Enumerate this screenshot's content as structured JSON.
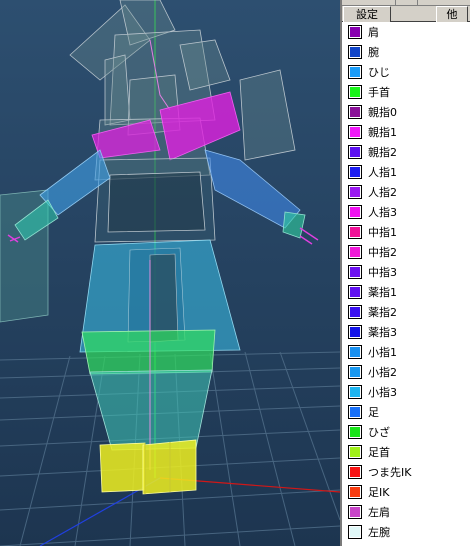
{
  "tabs": [
    {
      "label": "設定"
    },
    {
      "label": "他"
    }
  ],
  "bones": [
    {
      "label": "肩",
      "color": "#8800b0"
    },
    {
      "label": "腕",
      "color": "#1044c8"
    },
    {
      "label": "ひじ",
      "color": "#1a9cf8"
    },
    {
      "label": "手首",
      "color": "#18f418"
    },
    {
      "label": "親指0",
      "color": "#8a1098"
    },
    {
      "label": "親指1",
      "color": "#f018f8"
    },
    {
      "label": "親指2",
      "color": "#5c10f0"
    },
    {
      "label": "人指1",
      "color": "#1c1cf0"
    },
    {
      "label": "人指2",
      "color": "#9a18f0"
    },
    {
      "label": "人指3",
      "color": "#f010f0"
    },
    {
      "label": "中指1",
      "color": "#f01098"
    },
    {
      "label": "中指2",
      "color": "#f018d8"
    },
    {
      "label": "中指3",
      "color": "#6c10f0"
    },
    {
      "label": "薬指1",
      "color": "#6010f0"
    },
    {
      "label": "薬指2",
      "color": "#3a10f0"
    },
    {
      "label": "薬指3",
      "color": "#1414e8"
    },
    {
      "label": "小指1",
      "color": "#1890f0"
    },
    {
      "label": "小指2",
      "color": "#1898f0"
    },
    {
      "label": "小指3",
      "color": "#1cb4f0"
    },
    {
      "label": "足",
      "color": "#1870f8"
    },
    {
      "label": "ひざ",
      "color": "#18e418"
    },
    {
      "label": "足首",
      "color": "#a0f018"
    },
    {
      "label": "つま先IK",
      "color": "#f81414"
    },
    {
      "label": "足IK",
      "color": "#f83c10"
    },
    {
      "label": "左肩",
      "color": "#c844c8"
    },
    {
      "label": "左腕",
      "color": "#e0f8f8"
    }
  ]
}
